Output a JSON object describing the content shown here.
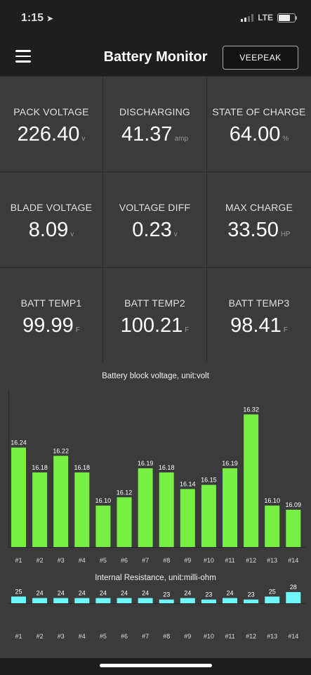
{
  "status": {
    "time": "1:15",
    "network": "LTE"
  },
  "header": {
    "title": "Battery Monitor",
    "device_button": "VEEPEAK"
  },
  "icons": {
    "menu": "hamburger-menu-icon",
    "location": "location-arrow-icon",
    "signal": "signal-bars-icon",
    "battery": "battery-icon"
  },
  "stats": [
    {
      "label": "PACK VOLTAGE",
      "value": "226.40",
      "unit": "v"
    },
    {
      "label": "DISCHARGING",
      "value": "41.37",
      "unit": "amp"
    },
    {
      "label": "STATE OF CHARGE",
      "value": "64.00",
      "unit": "%"
    },
    {
      "label": "BLADE VOLTAGE",
      "value": "8.09",
      "unit": "v"
    },
    {
      "label": "VOLTAGE DIFF",
      "value": "0.23",
      "unit": "v"
    },
    {
      "label": "MAX CHARGE",
      "value": "33.50",
      "unit": "HP"
    },
    {
      "label": "BATT TEMP1",
      "value": "99.99",
      "unit": "F"
    },
    {
      "label": "BATT TEMP2",
      "value": "100.21",
      "unit": "F"
    },
    {
      "label": "BATT TEMP3",
      "value": "98.41",
      "unit": "F"
    }
  ],
  "chart_data": [
    {
      "type": "bar",
      "title": "Battery block voltage, unit:volt",
      "categories": [
        "#1",
        "#2",
        "#3",
        "#4",
        "#5",
        "#6",
        "#7",
        "#8",
        "#9",
        "#10",
        "#11",
        "#12",
        "#13",
        "#14"
      ],
      "values": [
        16.24,
        16.18,
        16.22,
        16.18,
        16.1,
        16.12,
        16.19,
        16.18,
        16.14,
        16.15,
        16.19,
        16.32,
        16.1,
        16.09
      ],
      "labels": [
        "16.24",
        "16.18",
        "16.22",
        "16.18",
        "16.10",
        "16.12",
        "16.19",
        "16.18",
        "16.14",
        "16.15",
        "16.19",
        "16.32",
        "16.10",
        "16.09"
      ],
      "ylim": [
        16.0,
        16.38
      ],
      "color": "#77f043",
      "grid": false
    },
    {
      "type": "bar",
      "title": "Internal Resistance, unit:milli-ohm",
      "categories": [
        "#1",
        "#2",
        "#3",
        "#4",
        "#5",
        "#6",
        "#7",
        "#8",
        "#9",
        "#10",
        "#11",
        "#12",
        "#13",
        "#14"
      ],
      "values": [
        25,
        24,
        24,
        24,
        24,
        24,
        24,
        23,
        24,
        23,
        24,
        23,
        25,
        28
      ],
      "labels": [
        "25",
        "24",
        "24",
        "24",
        "24",
        "24",
        "24",
        "23",
        "24",
        "23",
        "24",
        "23",
        "25",
        "28"
      ],
      "ylim": [
        20.5,
        28.5
      ],
      "color": "#6ff6fd",
      "grid": false
    }
  ]
}
